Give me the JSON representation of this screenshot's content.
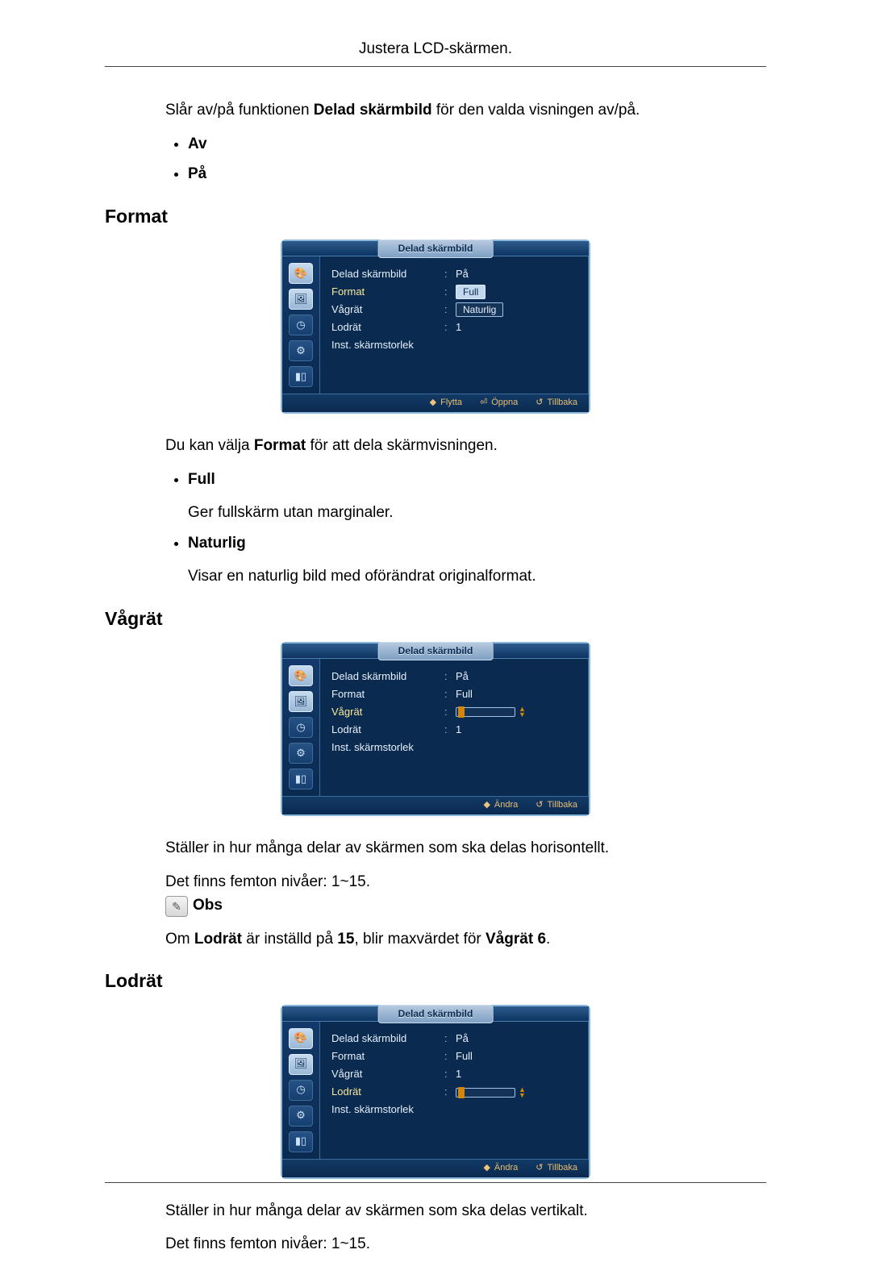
{
  "header": {
    "title": "Justera LCD-skärmen."
  },
  "intro": {
    "line_pre": "Slår av/på funktionen ",
    "line_bold": "Delad skärmbild",
    "line_post": " för den valda visningen av/på.",
    "bullets": [
      "Av",
      "På"
    ]
  },
  "sections": {
    "format": {
      "heading": "Format",
      "desc_pre": "Du kan välja ",
      "desc_bold": "Format",
      "desc_post": " för att dela skärmvisningen.",
      "items": [
        {
          "name": "Full",
          "desc": "Ger fullskärm utan marginaler."
        },
        {
          "name": "Naturlig",
          "desc": "Visar en naturlig bild med oförändrat originalformat."
        }
      ]
    },
    "vagrat": {
      "heading": "Vågrät",
      "desc": "Ställer in hur många delar av skärmen som ska delas horisontellt.",
      "levels": "Det finns femton nivåer: 1~15.",
      "note_label": "Obs",
      "note_pre": "Om ",
      "note_b1": "Lodrät",
      "note_mid": " är inställd på ",
      "note_b2": "15",
      "note_mid2": ", blir maxvärdet för ",
      "note_b3": "Vågrät 6",
      "note_post": "."
    },
    "lodrat": {
      "heading": "Lodrät",
      "desc": "Ställer in hur många delar av skärmen som ska delas vertikalt.",
      "levels": "Det finns femton nivåer: 1~15."
    }
  },
  "osd_common": {
    "title": "Delad skärmbild",
    "labels": {
      "delad": "Delad skärmbild",
      "format": "Format",
      "vagrat": "Vågrät",
      "lodrat": "Lodrät",
      "inst": "Inst. skärmstorlek"
    },
    "values": {
      "pa": "På",
      "full": "Full",
      "naturlig": "Naturlig",
      "one": "1"
    },
    "footer": {
      "flytta": "Flytta",
      "oppna": "Öppna",
      "tillbaka": "Tillbaka",
      "andra": "Ändra"
    }
  }
}
